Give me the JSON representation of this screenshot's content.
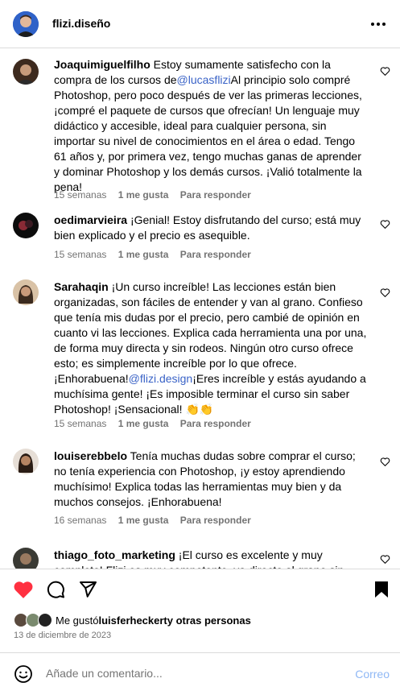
{
  "post_header": {
    "username": "flizi.diseño",
    "more_icon": "more-horizontal-icon"
  },
  "comments": [
    {
      "user": "Joaquimiguelfilho",
      "text_before": " Estoy sumamente satisfecho con la compra de los cursos de",
      "mention": "@lucasflizi",
      "text_after": "Al principio solo compré Photoshop, pero poco después de ver las primeras lecciones, ¡compré el paquete de cursos que ofrecían! Un lenguaje muy didáctico y accesible, ideal para cualquier persona, sin importar su nivel de conocimientos en el área o edad. Tengo 61 años y, por primera vez, tengo muchas ganas de aprender y dominar Photoshop y los demás cursos. ¡Valió totalmente la pena!",
      "time": "15 semanas",
      "likes": "1 me gusta",
      "reply": "Para responder"
    },
    {
      "user": "oedimarvieira",
      "text": " ¡Genial! Estoy disfrutando del curso; está muy bien explicado y el precio es asequible.",
      "time": "15 semanas",
      "likes": "1 me gusta",
      "reply": "Para responder"
    },
    {
      "user": "Sarahaqin",
      "text_before": " ¡Un curso increíble! Las lecciones están bien organizadas, son fáciles de entender y van al grano. Confieso que tenía mis dudas por el precio, pero cambié de opinión en cuanto vi las lecciones. Explica cada herramienta una por una, de forma muy directa y sin rodeos. Ningún otro curso ofrece esto; es simplemente increíble por lo que ofrece. ¡Enhorabuena!",
      "mention": "@flizi.design",
      "text_after": "¡Eres increíble y estás ayudando a muchísima gente! ¡Es imposible terminar el curso sin saber Photoshop! ¡Sensacional! 👏👏",
      "time": "15 semanas",
      "likes": "1 me gusta",
      "reply": "Para responder"
    },
    {
      "user": "louiserebbelo",
      "text": " Tenía muchas dudas sobre comprar el curso; no tenía experiencia con Photoshop, ¡y estoy aprendiendo muchísimo! Explica todas las herramientas muy bien y da muchos consejos. ¡Enhorabuena!",
      "time": "16 semanas",
      "likes": "1 me gusta",
      "reply": "Para responder"
    },
    {
      "user": "thiago_foto_marketing",
      "text": " ¡El curso es excelente y muy completo! Flizi es muy competente, va directo al grano sin rodeos, pero"
    }
  ],
  "actions": {
    "like_icon": "heart-filled-icon",
    "comment_icon": "comment-icon",
    "share_icon": "send-icon",
    "save_icon": "bookmark-filled-icon",
    "like_color": "#ff3040"
  },
  "likes_summary": {
    "prefix": "Me gustó ",
    "user": "luisferheckert",
    "suffix": " y otras personas"
  },
  "date": "13 de diciembre de 2023",
  "add_comment": {
    "placeholder": "Añade un comentario...",
    "post_label": "Correo",
    "post_color": "#8fb8f5"
  }
}
